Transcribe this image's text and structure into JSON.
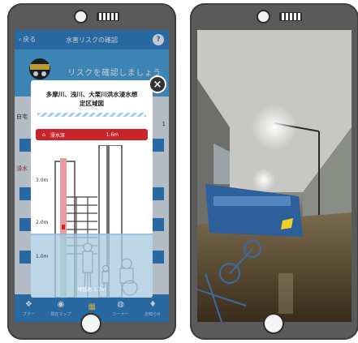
{
  "app": {
    "header_title": "水害リスクの確認",
    "back_label": "戻る",
    "help_label": "?",
    "intro_text": "リスクを確認しましょう",
    "bg_labels": {
      "left_top": "自宅",
      "left_mid": "浸水",
      "right_num": "1"
    }
  },
  "modal": {
    "title_line1": "多摩川、浅川、大栗川洪水浸水想",
    "title_line2": "定区域図",
    "bar_label": "浸水深",
    "bar_value": "1.6m",
    "depth_3": "3.0m",
    "depth_2": "2.0m",
    "depth_1": "1.0m",
    "caption": "地盤高 1.7m",
    "close_label": "×",
    "water_fraction": 0.42
  },
  "tabs": [
    {
      "label": "ブラー",
      "icon": "bird-icon"
    },
    {
      "label": "現在マップ",
      "icon": "pin-icon"
    },
    {
      "label": "",
      "icon": "grid-icon"
    },
    {
      "label": "シーナー",
      "icon": "globe-icon"
    },
    {
      "label": "お知らせ",
      "icon": "bell-icon"
    }
  ],
  "colors": {
    "accent_blue": "#2f7fc5",
    "sky_blue": "#4aa3dd",
    "alert_red": "#c8242a",
    "water": "#a9cbe0"
  }
}
